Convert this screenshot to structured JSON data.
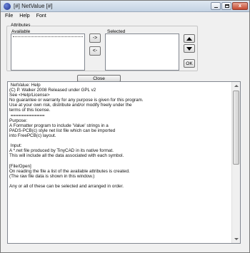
{
  "window": {
    "title": "[#] NetValue [#]",
    "buttons": {
      "close_label": "x"
    }
  },
  "menubar": {
    "items": [
      "File",
      "Help",
      "Font"
    ]
  },
  "attributes": {
    "group_title": "Attributes",
    "available_label": "Available",
    "selected_label": "Selected",
    "add_label": "->",
    "remove_label": "<-",
    "ok_label": "OK",
    "close_label": "Close"
  },
  "help_text": " NetValue: Help\n(C) P. Walker 2008 Released under GPL v2\nSee <Help/License>\nNo guarantee or warranty for any purpose is given for this program.\nUse at your own risk, distribute and/or modify freely under the\nterms of this license.\n =============\nPurpose:\nA Formatter program to include 'Value' strings in a\nPADS-PCB(c) style net list file which can be imported\ninto FreePCB(c) layout.\n\n Input:\nA *.net file produced by TinyCAD in its native format.\nThis will include all the data associated with each symbol.\n\n[File/Open]\nOn reading the file a list of the available attributes is created.\n(The raw file data is shown in this window.)\n\nAny or all of these can be selected and arranged in order."
}
